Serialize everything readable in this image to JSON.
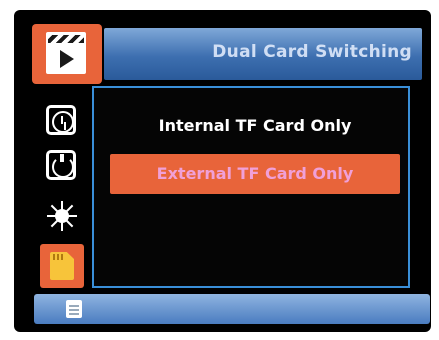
{
  "header": {
    "title": "Dual Card Switching"
  },
  "sidebar": {
    "items": [
      {
        "icon": "video-icon",
        "active": true
      },
      {
        "icon": "clock-icon",
        "active": false
      },
      {
        "icon": "timer-icon",
        "active": false
      },
      {
        "icon": "brightness-icon",
        "active": false
      },
      {
        "icon": "sd-card-icon",
        "active": true
      }
    ]
  },
  "submenu": {
    "options": [
      {
        "label": "Internal TF Card Only",
        "selected": false
      },
      {
        "label": "External TF Card Only",
        "selected": true
      }
    ]
  },
  "colors": {
    "accent": "#e8643a",
    "highlight_text": "#f0a0d8",
    "panel_border": "#3a8fd8",
    "header_bar": "#3d6fb0"
  }
}
